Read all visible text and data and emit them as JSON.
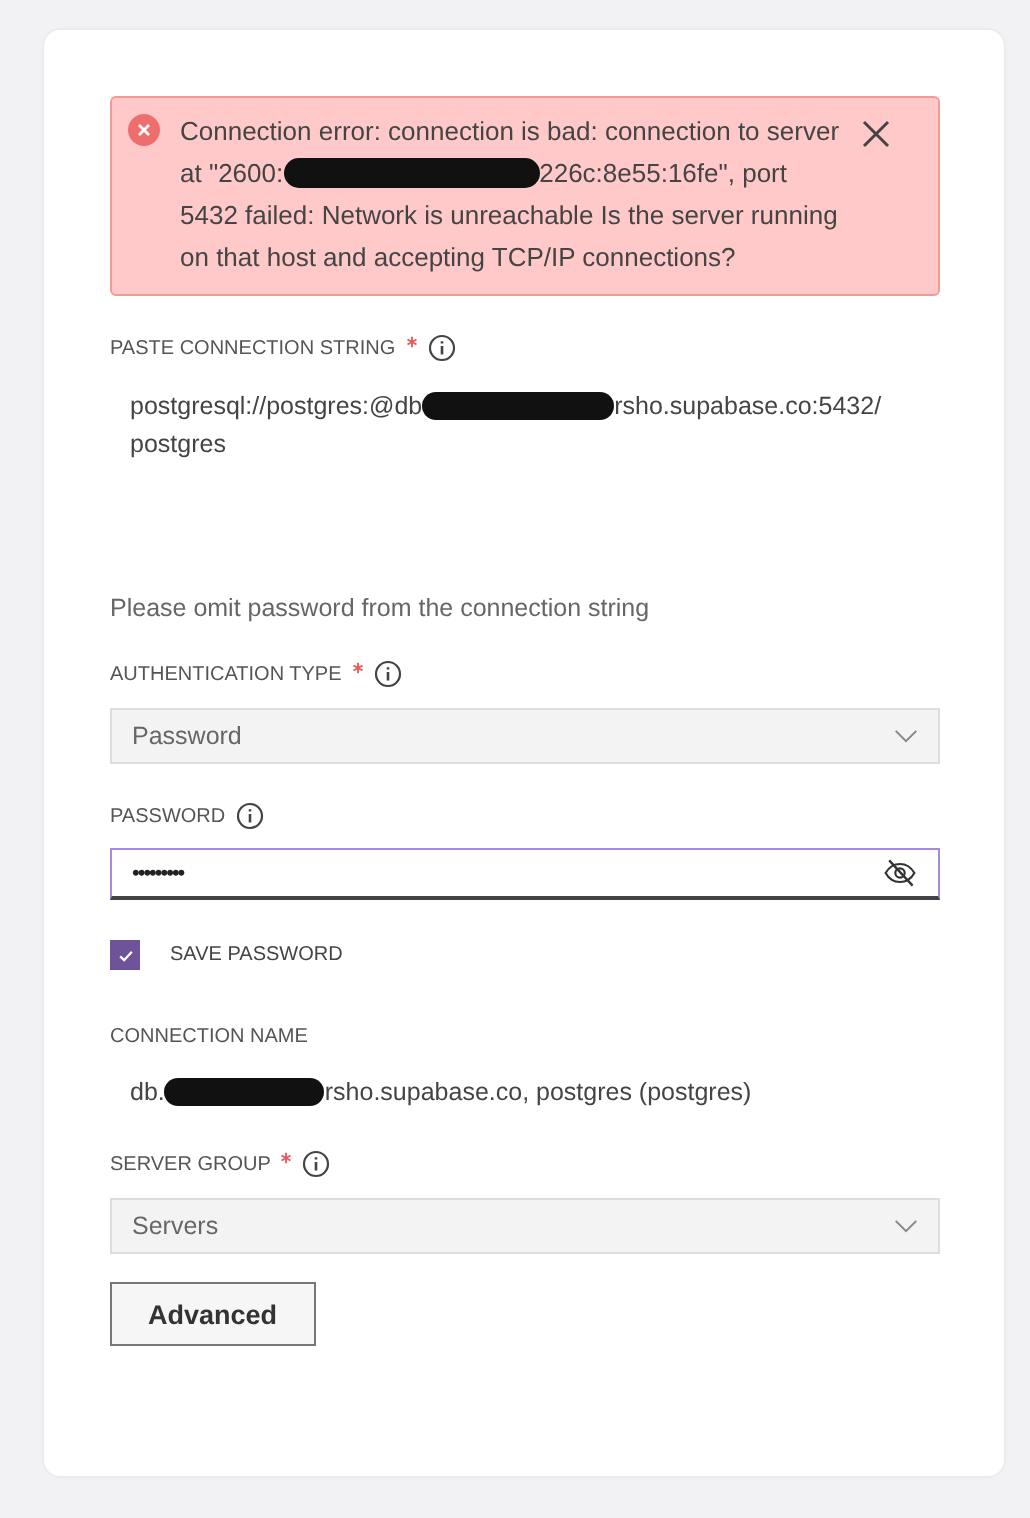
{
  "error": {
    "message_parts": [
      "Connection error: connection is bad: connection to server at \"2600:",
      "226c:8e55:16fe\", port 5432 failed: Network is unreachable Is the server running on that host and accepting TCP/IP connections?"
    ]
  },
  "connection_string": {
    "label": "PASTE CONNECTION STRING",
    "required": true,
    "value_parts": [
      "postgresql://postgres:@db",
      "rsho.supabase.co:5432/ postgres"
    ],
    "hint": "Please omit password from the connection string"
  },
  "authentication_type": {
    "label": "AUTHENTICATION TYPE",
    "required": true,
    "value": "Password"
  },
  "password": {
    "label": "PASSWORD",
    "required": false,
    "value": "•••••••••",
    "focused": true
  },
  "save_password": {
    "label": "SAVE PASSWORD",
    "checked": true
  },
  "connection_name": {
    "label": "CONNECTION NAME",
    "value_parts": [
      "db.",
      "rsho.supabase.co, postgres (postgres)"
    ]
  },
  "server_group": {
    "label": "SERVER GROUP",
    "required": true,
    "value": "Servers"
  },
  "advanced_button": "Advanced"
}
